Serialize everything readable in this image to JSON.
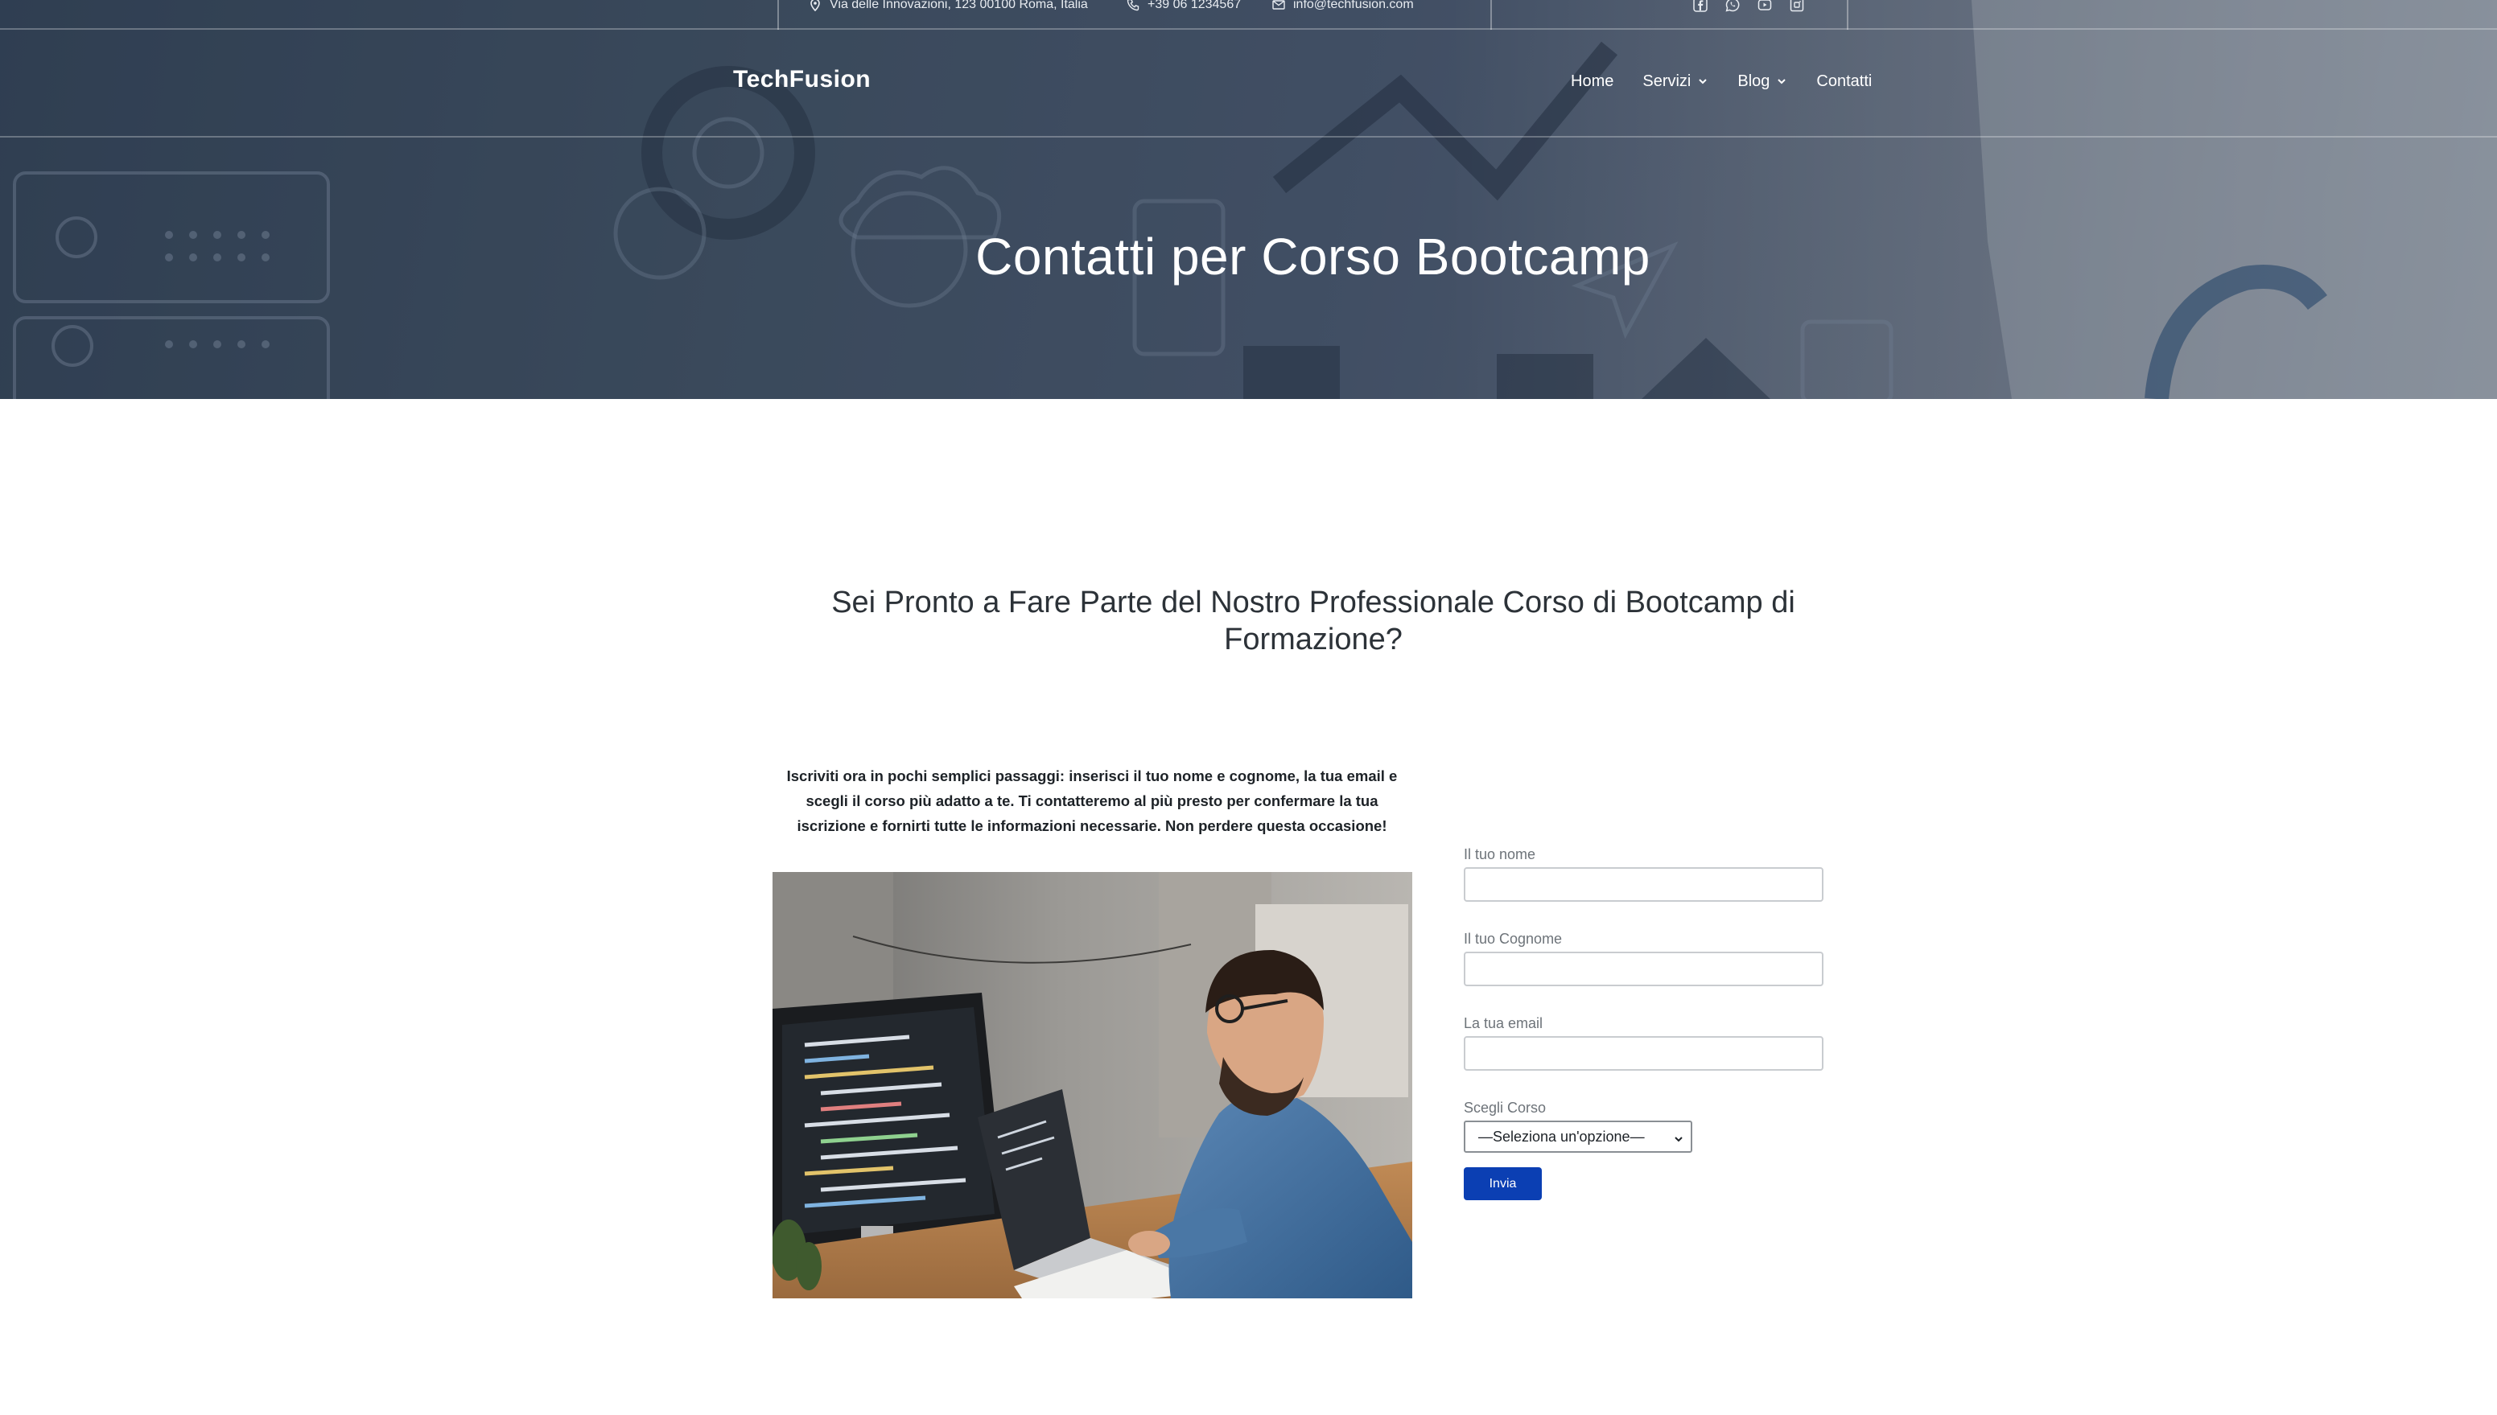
{
  "topbar": {
    "address": "Via delle Innovazioni, 123 00100 Roma, Italia",
    "phone": "+39 06 1234567",
    "email": "info@techfusion.com",
    "socials": [
      "facebook-icon",
      "whatsapp-icon",
      "youtube-icon",
      "instagram-icon"
    ]
  },
  "header": {
    "brand": "TechFusion",
    "nav": [
      {
        "label": "Home",
        "has_dropdown": false
      },
      {
        "label": "Servizi",
        "has_dropdown": true
      },
      {
        "label": "Blog",
        "has_dropdown": true
      },
      {
        "label": "Contatti",
        "has_dropdown": false
      }
    ]
  },
  "hero": {
    "title": "Contatti per Corso Bootcamp"
  },
  "main": {
    "heading": "Sei Pronto a Fare Parte del Nostro Professionale Corso di Bootcamp di Formazione?",
    "intro": "Iscriviti ora in pochi semplici passaggi: inserisci il tuo nome e cognome, la tua email e scegli il corso più adatto a te. Ti contatteremo al più presto per confermare la tua iscrizione e fornirti tutte le informazioni necessarie. Non perdere questa occasione!"
  },
  "form": {
    "name_label": "Il tuo nome",
    "surname_label": "Il tuo Cognome",
    "email_label": "La tua email",
    "course_label": "Scegli Corso",
    "course_selected": "—Seleziona un'opzione—",
    "submit_label": "Invia"
  },
  "colors": {
    "accent": "#0b3fb3",
    "heading_text": "#2c3238",
    "hero_overlay": "#3a4b5e"
  }
}
